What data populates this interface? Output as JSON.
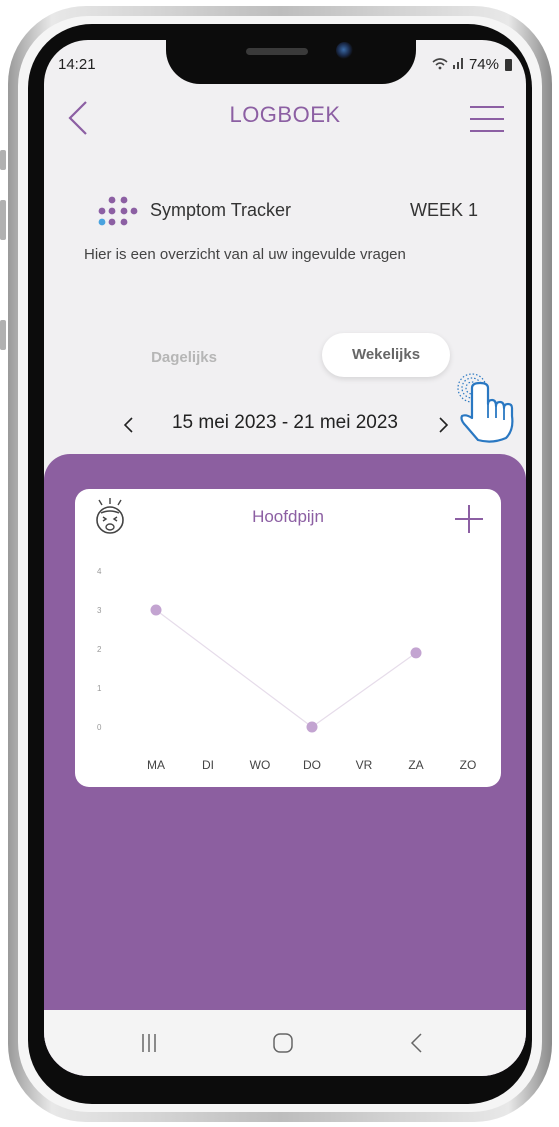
{
  "status": {
    "time": "14:21",
    "battery": "74%"
  },
  "header": {
    "title": "LOGBOEK"
  },
  "tracker": {
    "name": "Symptom Tracker",
    "week": "WEEK 1",
    "description": "Hier is een overzicht van al uw ingevulde vragen"
  },
  "tabs": {
    "daily": "Dagelijks",
    "weekly": "Wekelijks"
  },
  "date_range": "15 mei 2023 - 21 mei 2023",
  "card": {
    "title": "Hoofdpijn"
  },
  "colors": {
    "accent": "#8c5fa3",
    "panel": "#8c5fa0",
    "point": "#c3a4d1"
  },
  "chart_data": {
    "type": "line",
    "categories": [
      "MA",
      "DI",
      "WO",
      "DO",
      "VR",
      "ZA",
      "ZO"
    ],
    "values": [
      3,
      null,
      null,
      0,
      null,
      1.9,
      null
    ],
    "yticks": [
      0,
      1,
      2,
      3,
      4
    ],
    "ylim": [
      0,
      4
    ],
    "grid": false
  }
}
